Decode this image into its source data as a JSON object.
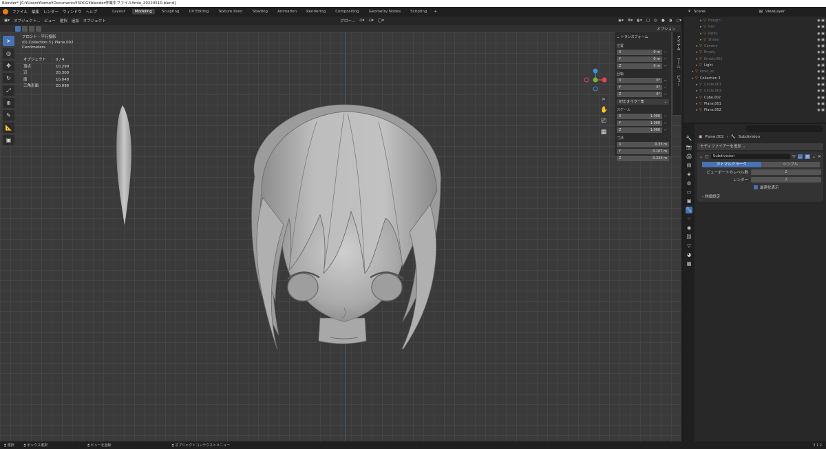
{
  "window": {
    "title": "Blender* [C:¥Users¥komo¥Documents¥3DCG¥blender作業中ファイル¥mio_20220510.blend]"
  },
  "menu": {
    "items": [
      "ファイル",
      "編集",
      "レンダー",
      "ウィンドウ",
      "ヘルプ"
    ]
  },
  "workspaces": {
    "tabs": [
      "Layout",
      "Modeling",
      "Sculpting",
      "UV Editing",
      "Texture Paint",
      "Shading",
      "Animation",
      "Rendering",
      "Compositing",
      "Geometry Nodes",
      "Scripting"
    ],
    "active": "Modeling",
    "add_icon": "+"
  },
  "viewport_header": {
    "mode": "オブジェクト...",
    "view": "ビュー",
    "select": "選択",
    "add": "追加",
    "object": "オブジェクト",
    "orientation": "グロー...",
    "options": "オプション"
  },
  "viewport_info": {
    "view_name": "フロント・平行投影",
    "collection": "(0) Collection 3 | Plane.002",
    "units": "Centimeters"
  },
  "stats": [
    {
      "label": "オブジェクト",
      "value": "0 / 4"
    },
    {
      "label": "頂点",
      "value": "10,299"
    },
    {
      "label": "辺",
      "value": "20,300"
    },
    {
      "label": "面",
      "value": "10,048"
    },
    {
      "label": "三角形面",
      "value": "20,096"
    }
  ],
  "transform": {
    "title": "トランスフォーム",
    "location_label": "位置",
    "location": [
      {
        "axis": "X",
        "value": "0 m"
      },
      {
        "axis": "Y",
        "value": "0 m"
      },
      {
        "axis": "Z",
        "value": "0 m"
      }
    ],
    "rotation_label": "回転",
    "rotation": [
      {
        "axis": "X",
        "value": "0°"
      },
      {
        "axis": "Y",
        "value": "0°"
      },
      {
        "axis": "Z",
        "value": "0°"
      }
    ],
    "rotation_mode": "XYZ オイラー角",
    "scale_label": "スケール",
    "scale": [
      {
        "axis": "X",
        "value": "1.000"
      },
      {
        "axis": "Y",
        "value": "1.000"
      },
      {
        "axis": "Z",
        "value": "1.000"
      }
    ],
    "dimensions_label": "寸法",
    "dimensions": [
      {
        "axis": "X",
        "value": "0.35 m"
      },
      {
        "axis": "Y",
        "value": "0.107 m"
      },
      {
        "axis": "Z",
        "value": "0.244 m"
      }
    ]
  },
  "npanel_tabs": {
    "item": "アイテム",
    "tool": "ツール",
    "view": "ビュー"
  },
  "outliner": {
    "scene": "Scene",
    "view_layer": "ViewLayer",
    "rows": [
      {
        "name": "Hangin",
        "indent": 3,
        "dim": true
      },
      {
        "name": "hair",
        "indent": 3,
        "dim": true
      },
      {
        "name": "Pants",
        "indent": 3,
        "dim": true
      },
      {
        "name": "Shoes",
        "indent": 3,
        "dim": true
      },
      {
        "name": "Camera",
        "indent": 2,
        "dim": true
      },
      {
        "name": "Empty",
        "indent": 2,
        "dim": true
      },
      {
        "name": "Empty.001",
        "indent": 2,
        "dim": true
      },
      {
        "name": "Light",
        "indent": 2,
        "dim": false
      },
      {
        "name": "kmio_ac",
        "indent": 1,
        "dim": true
      },
      {
        "name": "Collection 3",
        "indent": 1,
        "dim": false
      },
      {
        "name": "Circle.001",
        "indent": 2,
        "dim": true
      },
      {
        "name": "Circle.002",
        "indent": 2,
        "dim": true
      },
      {
        "name": "Cube.002",
        "indent": 2,
        "dim": false
      },
      {
        "name": "Plane.001",
        "indent": 2,
        "dim": false
      },
      {
        "name": "Plane.002",
        "indent": 2,
        "dim": false
      }
    ]
  },
  "properties": {
    "object": "Plane.002",
    "modifier": "Subdivision",
    "add_modifier": "モディファイアーを追加",
    "mod_name": "Subdivision",
    "seg_catmull": "カトマルクラーク",
    "seg_simple": "シンプル",
    "viewport_levels_label": "ビューポートのレベル数",
    "viewport_levels": "2",
    "render_label": "レンダー",
    "render_levels": "2",
    "optimal_label": "最適化表示",
    "advanced": "詳細設定"
  },
  "status": {
    "select": "選択",
    "box_select": "ボックス選択",
    "rotate_view": "ビューを回転",
    "context_menu": "オブジェクトコンテクストメニュー",
    "version": "3.1.2"
  },
  "colors": {
    "accent": "#4772b3",
    "axis_x": "#e34354",
    "axis_y": "#7bb62f",
    "axis_z": "#3d8cdb"
  }
}
